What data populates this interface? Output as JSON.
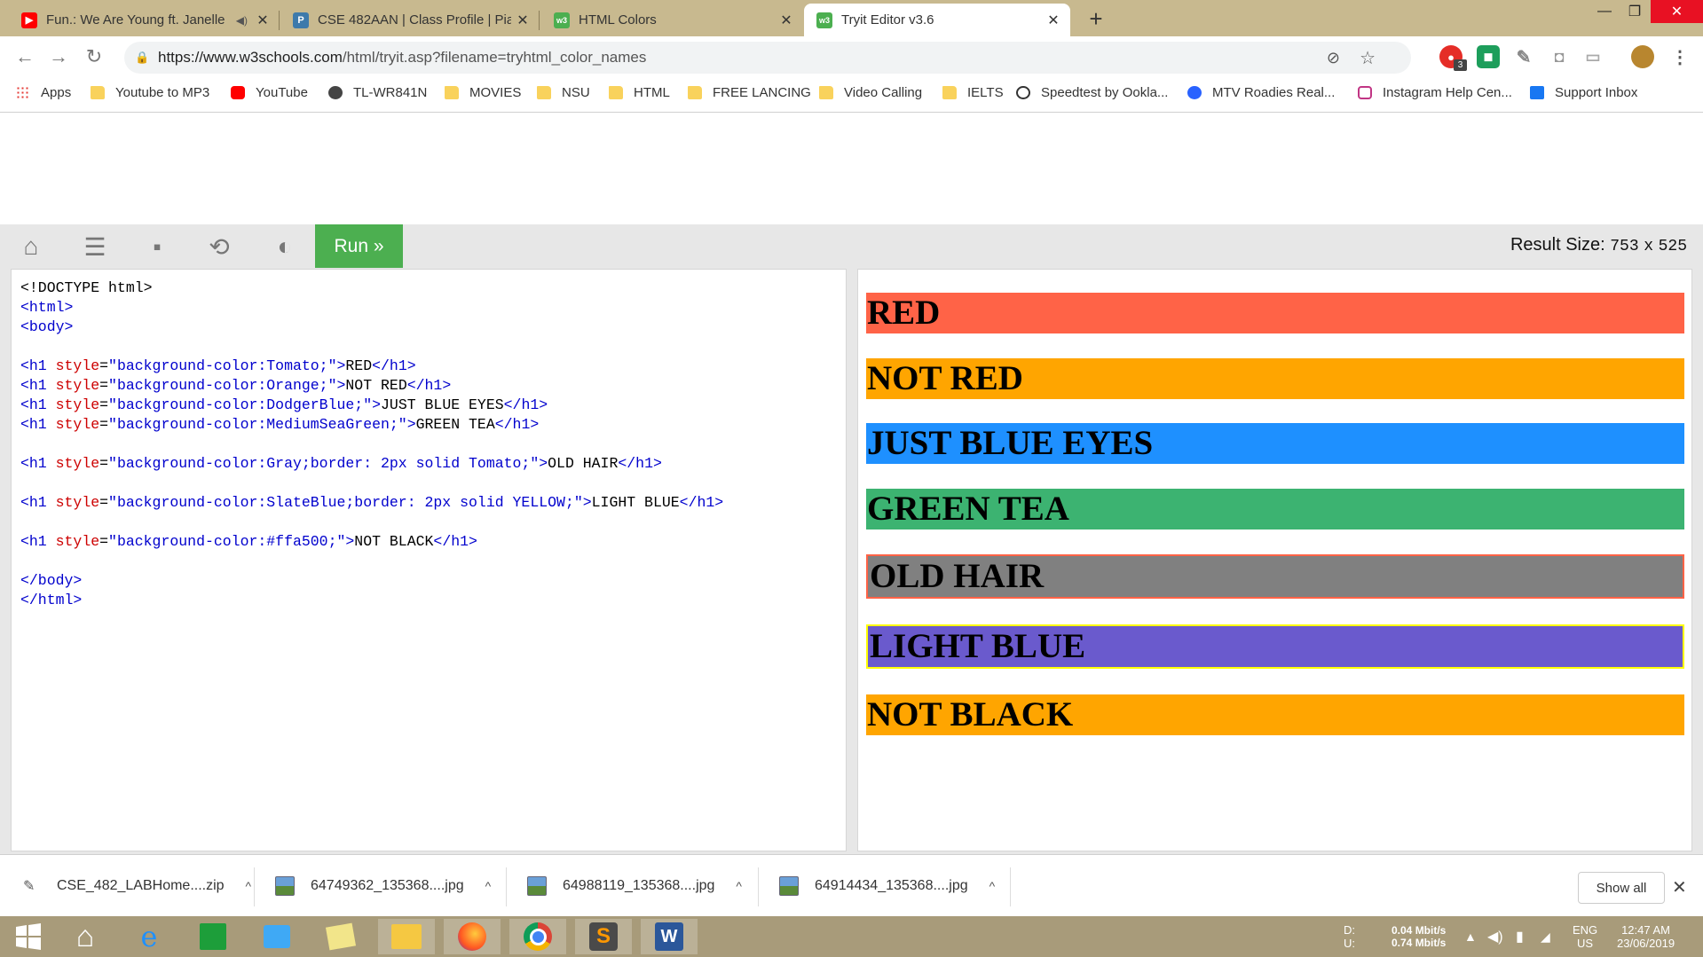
{
  "browser": {
    "tabs": [
      {
        "title": "Fun.: We Are Young ft. Janelle",
        "favicon": "youtube-icon",
        "color": "#ff0000"
      },
      {
        "title": "CSE 482AAN | Class Profile | Piazza",
        "favicon": "piazza-icon",
        "color": "#3e7aab"
      },
      {
        "title": "HTML Colors",
        "favicon": "w3schools-icon",
        "color": "#4caf50"
      },
      {
        "title": "Tryit Editor v3.6",
        "favicon": "w3schools-icon",
        "color": "#4caf50"
      }
    ],
    "active_tab": 3,
    "address": {
      "host": "https://www.w3schools.com",
      "path": "/html/tryit.asp?filename=tryhtml_color_names"
    },
    "bookmarks": [
      {
        "label": "Apps",
        "icon": "apps-grid-icon"
      },
      {
        "label": "Youtube to MP3",
        "icon": "folder-icon"
      },
      {
        "label": "YouTube",
        "icon": "youtube-icon"
      },
      {
        "label": "TL-WR841N",
        "icon": "globe-icon"
      },
      {
        "label": "MOVIES",
        "icon": "folder-icon"
      },
      {
        "label": "NSU",
        "icon": "folder-icon"
      },
      {
        "label": "HTML",
        "icon": "folder-icon"
      },
      {
        "label": "FREE LANCING",
        "icon": "folder-icon"
      },
      {
        "label": "Video Calling",
        "icon": "folder-icon"
      },
      {
        "label": "IELTS",
        "icon": "folder-icon"
      },
      {
        "label": "Speedtest by Ookla...",
        "icon": "speedtest-icon"
      },
      {
        "label": "MTV Roadies Real...",
        "icon": "roadies-icon"
      },
      {
        "label": "Instagram Help Cen...",
        "icon": "instagram-icon"
      },
      {
        "label": "Support Inbox",
        "icon": "facebook-icon"
      }
    ],
    "extension_badge": "3"
  },
  "tryit": {
    "run_label": "Run »",
    "result_size_label": "Result Size:",
    "result_width": "753",
    "result_x": "x",
    "result_height": "525",
    "code_lines": {
      "l1": "<!DOCTYPE html>",
      "l2_tag": "<html>",
      "l3_tag": "<body>",
      "h1_open": "<h1",
      "style_attr": " style",
      "eq": "=",
      "v1": "\"background-color:Tomato;\"",
      "v2": "\"background-color:Orange;\"",
      "v3": "\"background-color:DodgerBlue;\"",
      "v4": "\"background-color:MediumSeaGreen;\"",
      "v5": "\"background-color:Gray;border: 2px solid Tomato;\"",
      "v6": "\"background-color:SlateBlue;border: 2px solid YELLOW;\"",
      "v7": "\"background-color:#ffa500;\"",
      "gt": ">",
      "t1": "RED",
      "t2": "NOT RED",
      "t3": "JUST BLUE EYES",
      "t4": "GREEN TEA",
      "t5": "OLD HAIR",
      "t6": "LIGHT BLUE",
      "t7": "NOT BLACK",
      "h1_close": "</h1>",
      "body_close": "</body>",
      "html_close": "</html>"
    },
    "result_headings": [
      {
        "text": "RED",
        "bg": "#ff6347",
        "border": ""
      },
      {
        "text": "NOT RED",
        "bg": "#ffa500",
        "border": ""
      },
      {
        "text": "JUST BLUE EYES",
        "bg": "#1e90ff",
        "border": ""
      },
      {
        "text": "GREEN TEA",
        "bg": "#3cb371",
        "border": ""
      },
      {
        "text": "OLD HAIR",
        "bg": "#808080",
        "border": "#ff6347"
      },
      {
        "text": "LIGHT BLUE",
        "bg": "#6a5acd",
        "border": "#ffff00"
      },
      {
        "text": "NOT BLACK",
        "bg": "#ffa500",
        "border": ""
      }
    ]
  },
  "downloads": {
    "items": [
      {
        "name": "CSE_482_LABHome....zip",
        "icon": "zip-file-icon"
      },
      {
        "name": "64749362_135368....jpg",
        "icon": "image-file-icon"
      },
      {
        "name": "64988119_135368....jpg",
        "icon": "image-file-icon"
      },
      {
        "name": "64914434_135368....jpg",
        "icon": "image-file-icon"
      }
    ],
    "show_all_label": "Show all"
  },
  "taskbar": {
    "net_d_label": "D:",
    "net_u_label": "U:",
    "net_down": "0.04 Mbit/s",
    "net_up": "0.74 Mbit/s",
    "lang": "ENG",
    "region": "US",
    "time": "12:47 AM",
    "date": "23/06/2019"
  }
}
